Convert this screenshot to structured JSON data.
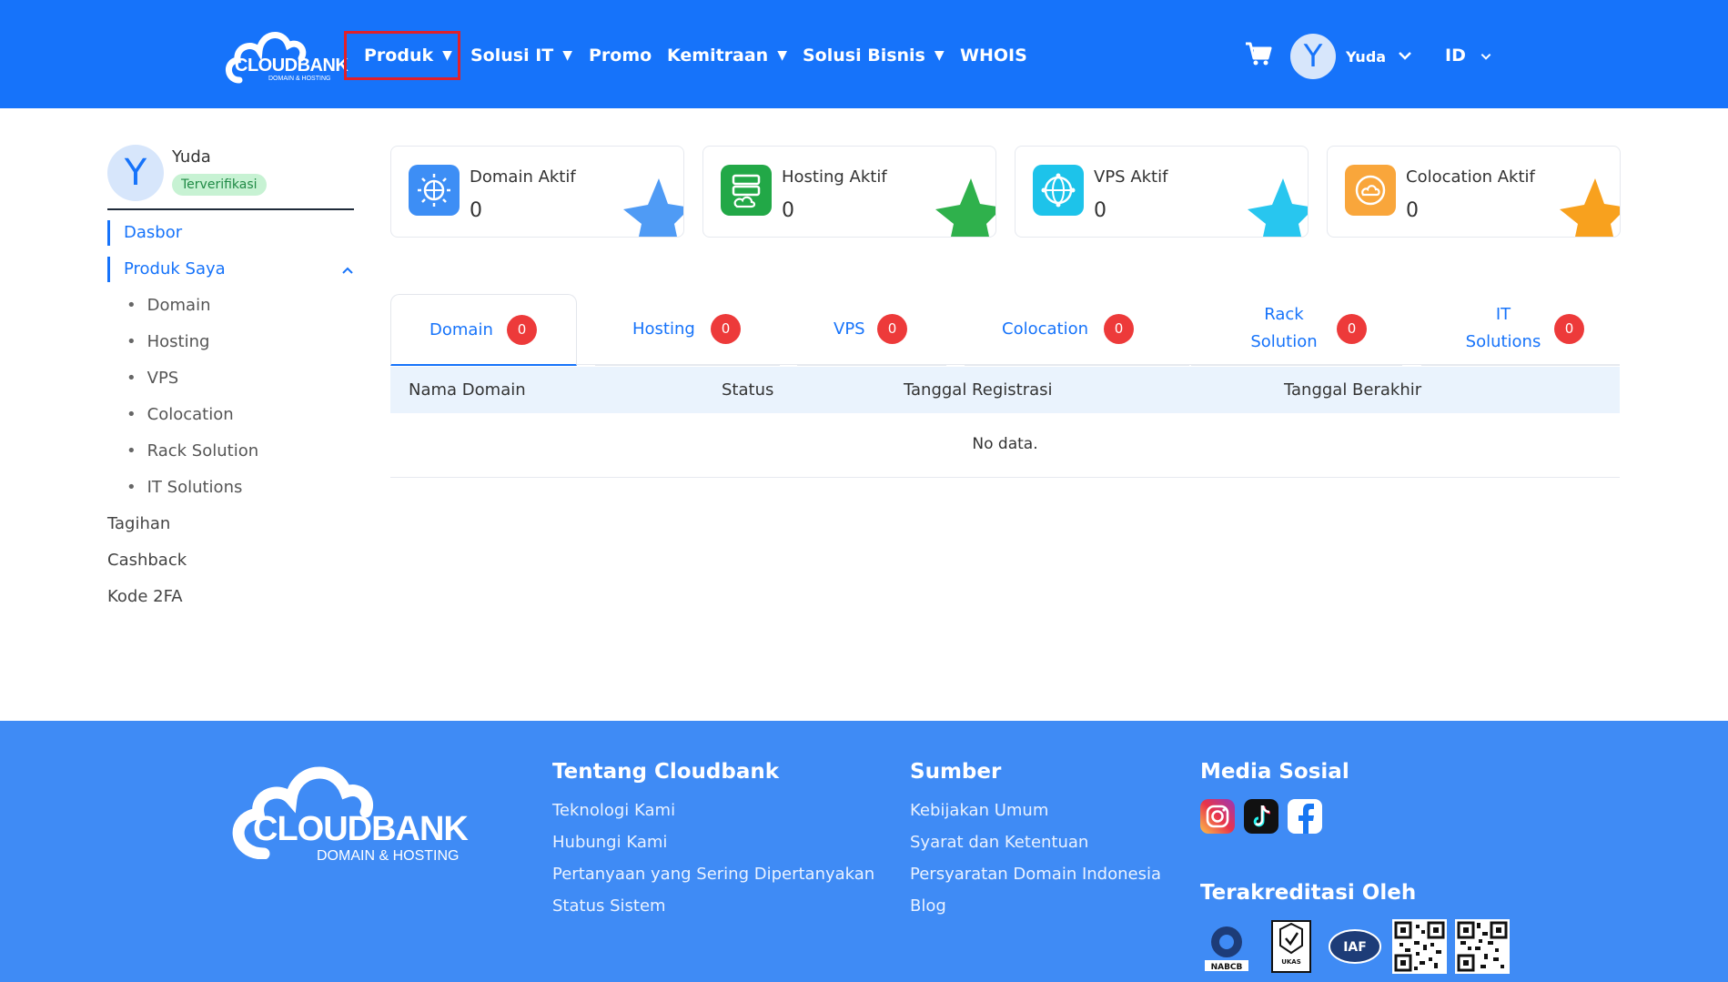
{
  "brand": {
    "logo_text": "CLOUDBANK",
    "logo_sub": "DOMAIN & HOSTING"
  },
  "nav": {
    "items": [
      {
        "label": "Produk",
        "has_caret": true
      },
      {
        "label": "Solusi IT",
        "has_caret": true
      },
      {
        "label": "Promo",
        "has_caret": false
      },
      {
        "label": "Kemitraan",
        "has_caret": true
      },
      {
        "label": "Solusi Bisnis",
        "has_caret": true
      },
      {
        "label": "WHOIS",
        "has_caret": false
      }
    ],
    "caret": "▼",
    "cart_icon": "cart-icon",
    "user_initial": "Y",
    "user_name": "Yuda",
    "lang": "ID"
  },
  "sidebar": {
    "avatar_initial": "Y",
    "name": "Yuda",
    "badge": "Terverifikasi",
    "links": [
      {
        "label": "Dasbor"
      },
      {
        "label": "Produk Saya"
      }
    ],
    "sub_items": [
      "Domain",
      "Hosting",
      "VPS",
      "Colocation",
      "Rack Solution",
      "IT Solutions"
    ],
    "bottom_links": [
      "Tagihan",
      "Cashback",
      "Kode 2FA"
    ]
  },
  "cards": [
    {
      "title": "Domain Aktif",
      "value": "0",
      "color": "#3d8ef5",
      "star": "#4f9bf5",
      "icon": "globe-network-icon"
    },
    {
      "title": "Hosting Aktif",
      "value": "0",
      "color": "#22a847",
      "star": "#2fb14c",
      "icon": "server-icon"
    },
    {
      "title": "VPS Aktif",
      "value": "0",
      "color": "#1dc3ea",
      "star": "#28c6ef",
      "icon": "vps-network-icon"
    },
    {
      "title": "Colocation Aktif",
      "value": "0",
      "color": "#f9a63b",
      "star": "#f8a11e",
      "icon": "colocation-cloud-icon"
    }
  ],
  "tabs": [
    {
      "label": "Domain",
      "count": "0"
    },
    {
      "label": "Hosting",
      "count": "0"
    },
    {
      "label": "VPS",
      "count": "0"
    },
    {
      "label": "Colocation",
      "count": "0"
    },
    {
      "label_line1": "Rack",
      "label_line2": "Solution",
      "count": "0"
    },
    {
      "label_line1": "IT",
      "label_line2": "Solutions",
      "count": "0"
    }
  ],
  "table": {
    "columns": [
      "Nama Domain",
      "Status",
      "Tanggal Registrasi",
      "Tanggal Berakhir"
    ],
    "empty_text": "No data."
  },
  "footer": {
    "logo_text": "CLOUDBANK",
    "logo_sub": "DOMAIN & HOSTING",
    "col1": {
      "title": "Tentang Cloudbank",
      "links": [
        "Teknologi Kami",
        "Hubungi Kami",
        "Pertanyaan yang Sering Dipertanyakan",
        "Status Sistem"
      ]
    },
    "col2": {
      "title": "Sumber",
      "links": [
        "Kebijakan Umum",
        "Syarat dan Ketentuan",
        "Persyaratan Domain Indonesia",
        "Blog"
      ]
    },
    "col3": {
      "title": "Media Sosial",
      "social": [
        "instagram-icon",
        "tiktok-icon",
        "facebook-icon"
      ]
    },
    "col4": {
      "title": "Terakreditasi Oleh",
      "logos": [
        "NABCB",
        "UKAS",
        "IAF",
        "qr-code-1",
        "qr-code-2"
      ]
    }
  },
  "colors": {
    "primary": "#1673fa",
    "footer_bg": "#3f8bf5",
    "badge_red": "#ed3a3a",
    "highlight_red": "#e0202a"
  }
}
